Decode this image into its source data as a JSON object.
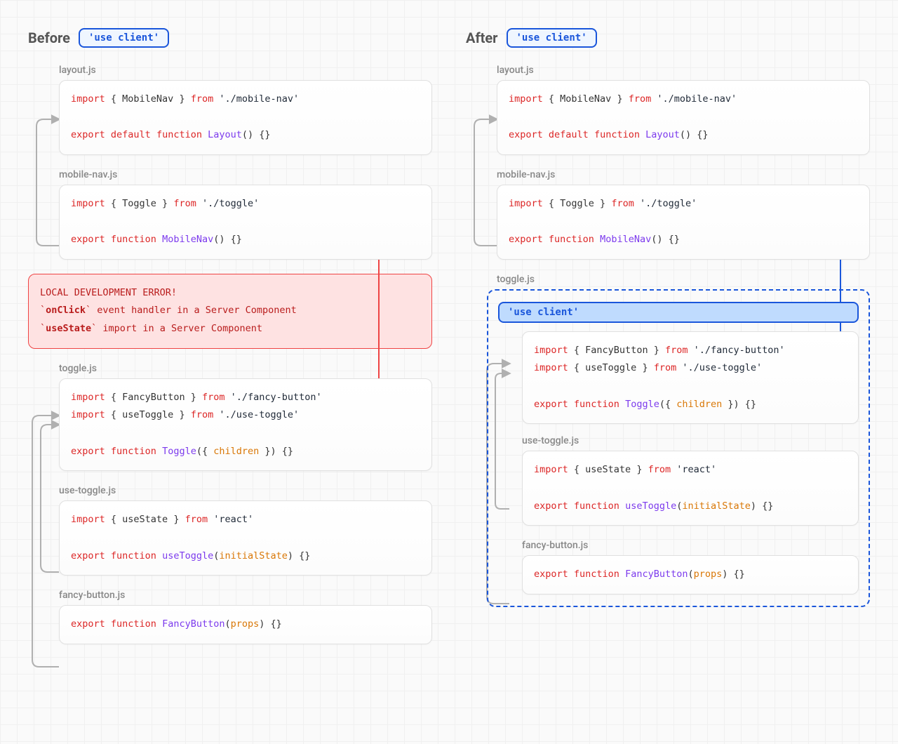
{
  "headers": {
    "before": "Before",
    "after": "After",
    "use_client": "'use client'"
  },
  "before": {
    "layout": {
      "file": "layout.js",
      "line1_import": "import",
      "line1_braces": " { MobileNav } ",
      "line1_from": "from",
      "line1_str": " './mobile-nav'",
      "line2_export": "export",
      "line2_default": " default ",
      "line2_function": "function",
      "line2_name": " Layout",
      "line2_tail": "() {}"
    },
    "mobilenav": {
      "file": "mobile-nav.js",
      "line1_import": "import",
      "line1_braces": " { Toggle } ",
      "line1_from": "from",
      "line1_str": " './toggle'",
      "line2_export": "export",
      "line2_function": " function",
      "line2_name": " MobileNav",
      "line2_tail": "() {}"
    },
    "error": {
      "title": "LOCAL DEVELOPMENT ERROR!",
      "l1_pre": "`",
      "l1_code": "onClick",
      "l1_post": "` event handler in a Server Component",
      "l2_pre": "`",
      "l2_code": "useState",
      "l2_post": "` import in a Server Component"
    },
    "toggle": {
      "file": "toggle.js",
      "line1_import": "import",
      "line1_braces": " { FancyButton } ",
      "line1_from": "from",
      "line1_str": " './fancy-button'",
      "line2_import": "import",
      "line2_braces": " { useToggle } ",
      "line2_from": "from",
      "line2_str": " './use-toggle'",
      "line3_export": "export",
      "line3_function": " function",
      "line3_name": " Toggle",
      "line3_open": "({ ",
      "line3_param": "children",
      "line3_close": " }) {}"
    },
    "usetoggle": {
      "file": "use-toggle.js",
      "line1_import": "import",
      "line1_braces": " { useState } ",
      "line1_from": "from",
      "line1_str": " 'react'",
      "line2_export": "export",
      "line2_function": " function",
      "line2_name": " useToggle",
      "line2_open": "(",
      "line2_param": "initialState",
      "line2_close": ") {}"
    },
    "fancybutton": {
      "file": "fancy-button.js",
      "line1_export": "export",
      "line1_function": " function",
      "line1_name": " FancyButton",
      "line1_open": "(",
      "line1_param": "props",
      "line1_close": ") {}"
    }
  },
  "after": {
    "layout": {
      "file": "layout.js",
      "line1_import": "import",
      "line1_braces": " { MobileNav } ",
      "line1_from": "from",
      "line1_str": " './mobile-nav'",
      "line2_export": "export",
      "line2_default": " default ",
      "line2_function": "function",
      "line2_name": " Layout",
      "line2_tail": "() {}"
    },
    "mobilenav": {
      "file": "mobile-nav.js",
      "line1_import": "import",
      "line1_braces": " { Toggle } ",
      "line1_from": "from",
      "line1_str": " './toggle'",
      "line2_export": "export",
      "line2_function": " function",
      "line2_name": " MobileNav",
      "line2_tail": "() {}"
    },
    "boundary_label": "'use client'",
    "toggle": {
      "file": "toggle.js",
      "line1_import": "import",
      "line1_braces": " { FancyButton } ",
      "line1_from": "from",
      "line1_str": " './fancy-button'",
      "line2_import": "import",
      "line2_braces": " { useToggle } ",
      "line2_from": "from",
      "line2_str": " './use-toggle'",
      "line3_export": "export",
      "line3_function": " function",
      "line3_name": " Toggle",
      "line3_open": "({ ",
      "line3_param": "children",
      "line3_close": " }) {}"
    },
    "usetoggle": {
      "file": "use-toggle.js",
      "line1_import": "import",
      "line1_braces": " { useState } ",
      "line1_from": "from",
      "line1_str": " 'react'",
      "line2_export": "export",
      "line2_function": " function",
      "line2_name": " useToggle",
      "line2_open": "(",
      "line2_param": "initialState",
      "line2_close": ") {}"
    },
    "fancybutton": {
      "file": "fancy-button.js",
      "line1_export": "export",
      "line1_function": " function",
      "line1_name": " FancyButton",
      "line1_open": "(",
      "line1_param": "props",
      "line1_close": ") {}"
    }
  }
}
